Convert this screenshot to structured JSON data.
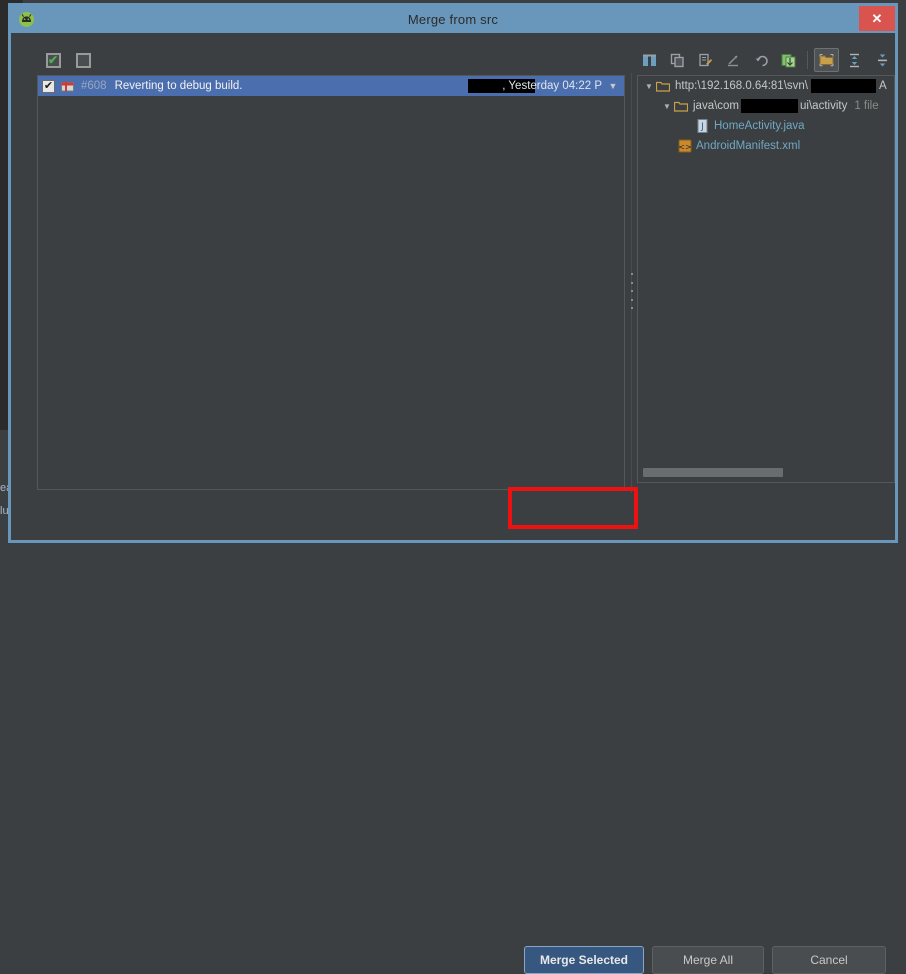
{
  "window": {
    "title": "Merge from src",
    "app_icon": "android-studio-icon",
    "close_label": "✕",
    "border_color": "#6897bb",
    "close_color": "#d9534f"
  },
  "background": {
    "fragment_top": "ea",
    "fragment_bottom": "lu"
  },
  "left_pane": {
    "toolbar": [
      {
        "name": "select-all-icon",
        "title": "Select All",
        "state": "checked"
      },
      {
        "name": "deselect-all-icon",
        "title": "Deselect All",
        "state": "unchecked"
      }
    ],
    "columns": [
      "revision",
      "message",
      "author",
      "date"
    ],
    "rows": [
      {
        "checked": true,
        "icon": "changelist-icon",
        "revision": "#608",
        "message": "Reverting to debug build.",
        "author_redacted": true,
        "date": ", Yesterday 04:22 P",
        "selected": true,
        "caret": "▼"
      }
    ]
  },
  "right_pane": {
    "toolbar": [
      {
        "name": "show-diff-icon",
        "title": "Show Diff",
        "pressed": false
      },
      {
        "name": "copy-icon",
        "title": "Copy",
        "pressed": false
      },
      {
        "name": "annotate-icon",
        "title": "Annotate",
        "pressed": false
      },
      {
        "name": "revert-icon",
        "title": "Revert",
        "pressed": false,
        "disabled": true
      },
      {
        "name": "rollback-icon",
        "title": "Rollback",
        "pressed": false
      },
      {
        "name": "show-changed-files-icon",
        "title": "Show Changed Files",
        "pressed": false
      },
      {
        "name": "group-by-directory-icon",
        "title": "Group by Directory",
        "pressed": true
      },
      {
        "name": "expand-all-icon",
        "title": "Expand All",
        "pressed": false
      },
      {
        "name": "collapse-all-icon",
        "title": "Collapse All",
        "pressed": false
      }
    ],
    "tree": [
      {
        "level": 0,
        "icon": "folder-icon",
        "caret": "▼",
        "label_before": "http:\\192.168.0.64:81\\svn\\",
        "redacted": true,
        "label_after": "A",
        "count": ""
      },
      {
        "level": 1,
        "icon": "folder-icon",
        "caret": "▼",
        "label_before": "java\\com",
        "redacted": true,
        "label_after": "ui\\activity",
        "count": "1 file"
      },
      {
        "level": 2,
        "icon": "java-file-icon",
        "caret": "",
        "label_before": "HomeActivity.java",
        "redacted": false,
        "label_after": "",
        "count": ""
      },
      {
        "level": 1,
        "icon": "xml-file-icon",
        "caret": "",
        "label_before": "AndroidManifest.xml",
        "redacted": false,
        "label_after": "",
        "count": ""
      }
    ],
    "scrollbar": {
      "name": "horizontal-scrollbar",
      "thumb_ratio": 0.57
    }
  },
  "footer": {
    "merge_selected_label": "Merge Selected",
    "merge_all_label": "Merge All",
    "cancel_label": "Cancel",
    "highlight_color": "#ee1111",
    "primary_color": "#365880"
  }
}
